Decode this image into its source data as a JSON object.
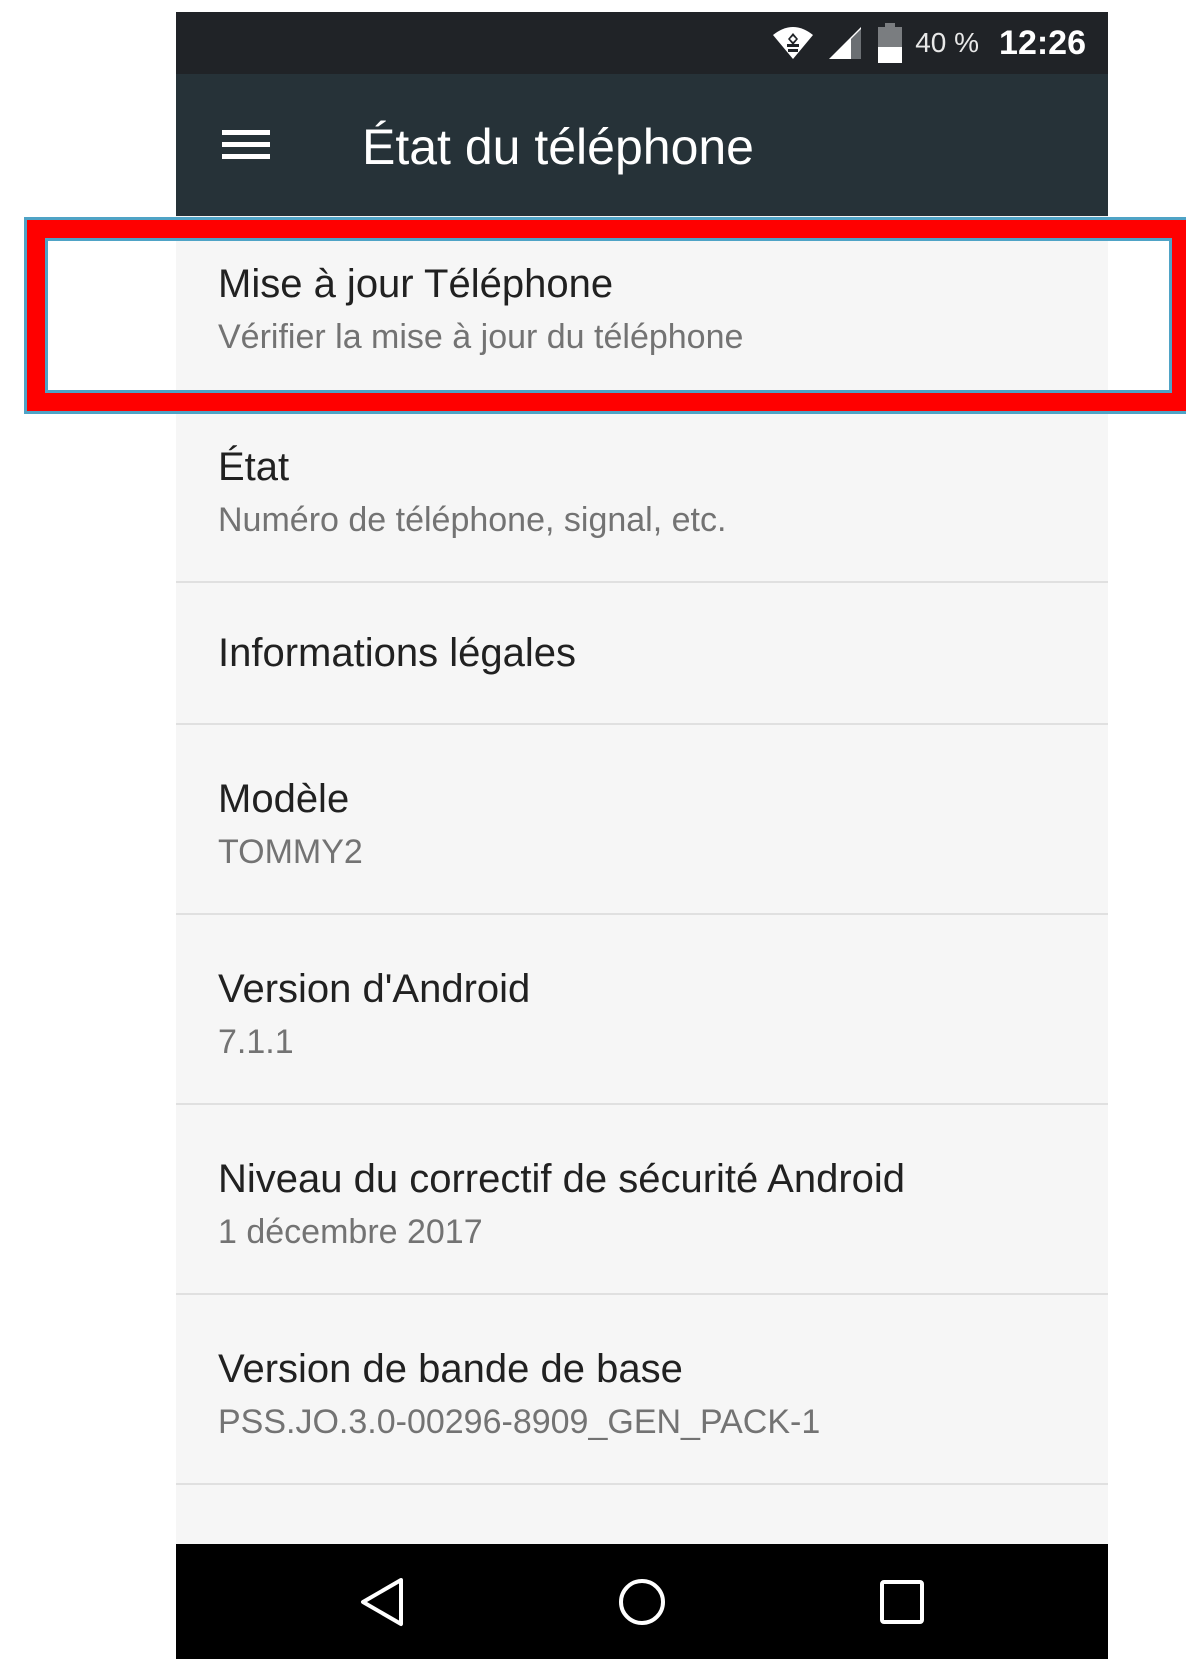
{
  "status_bar": {
    "battery_percent": "40 %",
    "time": "12:26",
    "icons": [
      "wifi-icon",
      "signal-icon",
      "battery-icon"
    ]
  },
  "toolbar": {
    "menu_icon": "hamburger-menu-icon",
    "title": "État du téléphone"
  },
  "list": {
    "items": [
      {
        "title": "Mise à jour Téléphone",
        "subtitle": "Vérifier la mise à jour du téléphone"
      },
      {
        "title": "État",
        "subtitle": "Numéro de téléphone, signal, etc."
      },
      {
        "title": "Informations légales"
      },
      {
        "title": "Modèle",
        "subtitle": "TOMMY2"
      },
      {
        "title": "Version d'Android",
        "subtitle": "7.1.1"
      },
      {
        "title": "Niveau du correctif de sécurité Android",
        "subtitle": "1 décembre 2017"
      },
      {
        "title": "Version de bande de base",
        "subtitle": "PSS.JO.3.0-00296-8909_GEN_PACK-1"
      }
    ]
  },
  "nav_bar": {
    "buttons": [
      "back-icon",
      "home-icon",
      "recents-icon"
    ]
  },
  "colors": {
    "status_bar": "#202327",
    "toolbar": "#263238",
    "background": "#f6f6f6",
    "highlight_red": "#ff0000",
    "highlight_blue": "#4fa3c6"
  }
}
